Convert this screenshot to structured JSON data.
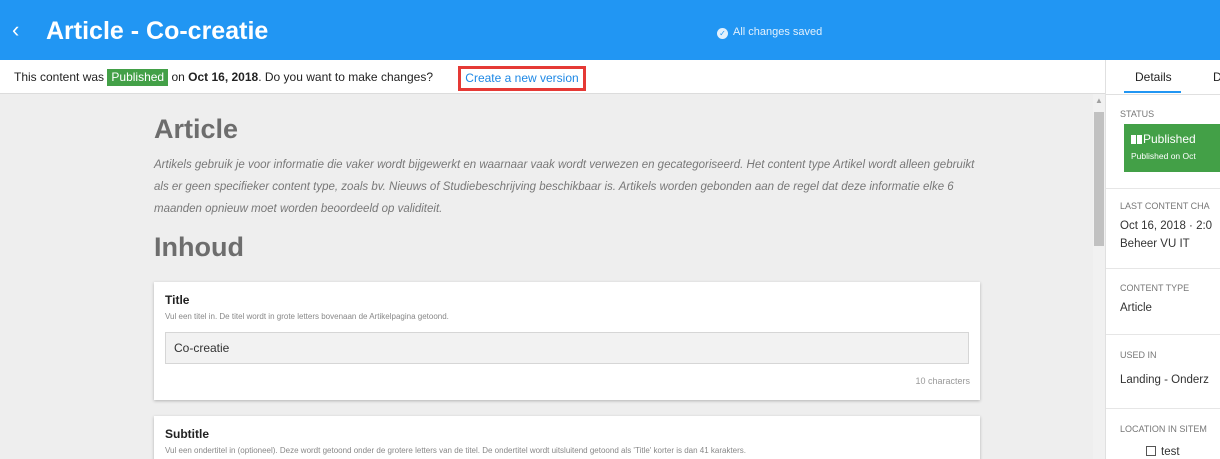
{
  "header": {
    "back_glyph": "‹",
    "title": "Article - Co-creatie",
    "save_status": "All changes saved"
  },
  "notice": {
    "prefix": "This content was",
    "status_badge": "Published",
    "middle": "on",
    "date": "Oct 16, 2018",
    "suffix": ". Do you want to make changes?",
    "link": "Create a new version"
  },
  "content": {
    "heading": "Article",
    "description": "Artikels gebruik je voor informatie die vaker wordt bijgewerkt en waarnaar vaak wordt verwezen en gecategoriseerd. Het content type Artikel wordt alleen gebruikt als er geen specifieker content type, zoals bv. Nieuws of Studiebeschrijving beschikbaar is. Artikels worden gebonden aan de regel dat deze informatie elke 6 maanden opnieuw moet worden beoordeeld op validiteit.",
    "section_heading": "Inhoud",
    "fields": [
      {
        "label": "Title",
        "help": "Vul een titel in. De titel wordt in grote letters bovenaan de Artikelpagina getoond.",
        "value": "Co-creatie",
        "char_count": "10 characters"
      },
      {
        "label": "Subtitle",
        "help": "Vul een ondertitel in (optioneel). Deze wordt getoond onder de grotere letters van de titel. De ondertitel wordt uitsluitend getoond als 'Title' korter is dan 41 karakters."
      }
    ]
  },
  "sidebar": {
    "tabs": [
      "Details",
      "D"
    ],
    "status_label": "STATUS",
    "status_value": "Published",
    "status_sub": "Published on Oct",
    "last_change_label": "LAST CONTENT CHA",
    "last_change_date": "Oct 16, 2018 · 2:0",
    "last_change_user": "Beheer VU IT",
    "content_type_label": "CONTENT TYPE",
    "content_type_value": "Article",
    "used_in_label": "USED IN",
    "used_in_value": "Landing - Onderz",
    "sitemap_label": "LOCATION IN SITEM",
    "sitemap_item": "test"
  },
  "colors": {
    "header_blue": "#2196f3",
    "published_green": "#43a047",
    "highlight_red": "#e53935",
    "link_blue": "#1e88e5"
  },
  "icons": {
    "back": "chevron-left-icon",
    "saved": "check-circle-icon",
    "status": "book-icon",
    "checkbox": "checkbox-icon"
  }
}
